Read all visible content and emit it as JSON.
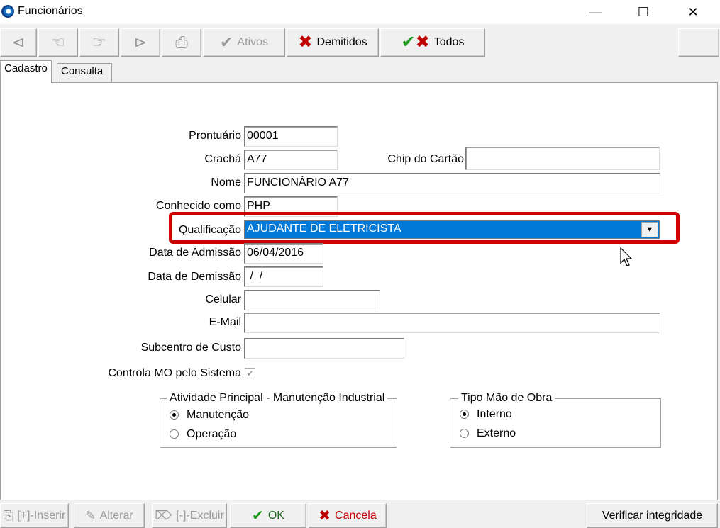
{
  "window": {
    "title": "Funcionários",
    "minimize": "—",
    "maximize": "☐",
    "close": "✕"
  },
  "toolbar": {
    "nav_icons": [
      "first-icon",
      "prev-icon",
      "next-icon",
      "last-icon",
      "print-icon"
    ],
    "ativos_label": "Ativos",
    "demitidos_label": "Demitidos",
    "todos_label": "Todos"
  },
  "tabs": [
    {
      "label": "Cadastro",
      "active": true
    },
    {
      "label": "Consulta",
      "active": false
    }
  ],
  "form": {
    "prontuario": {
      "label": "Prontuário",
      "value": "00001"
    },
    "cracha": {
      "label": "Crachá",
      "value": "A77"
    },
    "chip": {
      "label": "Chip do Cartão",
      "value": ""
    },
    "nome": {
      "label": "Nome",
      "value": "FUNCIONÁRIO A77"
    },
    "conhecido": {
      "label": "Conhecido como",
      "value": "PHP"
    },
    "qualificacao": {
      "label": "Qualificação",
      "value": "AJUDANTE DE ELETRICISTA"
    },
    "admissao": {
      "label": "Data de Admissão",
      "value": "06/04/2016"
    },
    "demissao": {
      "label": "Data de Demissão",
      "value": " /  /"
    },
    "celular": {
      "label": "Celular",
      "value": ""
    },
    "email": {
      "label": "E-Mail",
      "value": ""
    },
    "subcentro": {
      "label": "Subcentro de Custo",
      "value": ""
    },
    "controla_mo": {
      "label": "Controla MO pelo Sistema",
      "checked": true
    }
  },
  "atividade": {
    "title": "Atividade Principal - Manutenção Industrial",
    "options": [
      {
        "label": "Manutenção",
        "selected": true
      },
      {
        "label": "Operação",
        "selected": false
      }
    ]
  },
  "tipo_mo": {
    "title": "Tipo Mão de Obra",
    "options": [
      {
        "label": "Interno",
        "selected": true
      },
      {
        "label": "Externo",
        "selected": false
      }
    ]
  },
  "bottom": {
    "inserir": "[+]-Inserir",
    "alterar": "Alterar",
    "excluir": "[-]-Excluir",
    "ok": "OK",
    "cancela": "Cancela",
    "verificar": "Verificar integridade"
  },
  "colors": {
    "selection": "#0078d7",
    "highlight": "#d00000",
    "cancel": "#c00000",
    "ok": "#1e9a1e"
  }
}
